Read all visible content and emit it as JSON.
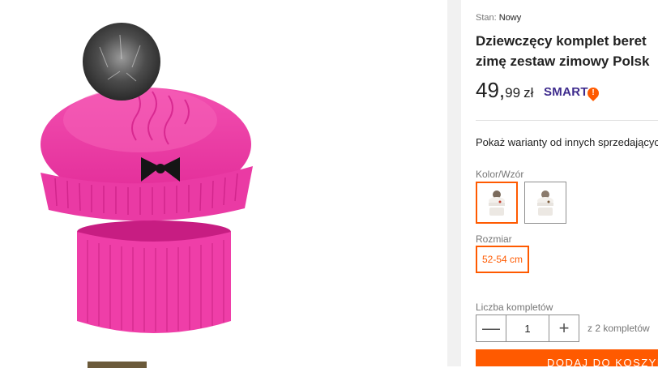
{
  "product": {
    "condition_label": "Stan:",
    "condition_value": "Nowy",
    "title_line1": "Dziewczęcy komplet beret",
    "title_line2": "zimę zestaw zimowy Polsk",
    "price_int": "49,",
    "price_frac": "99",
    "currency": "zł",
    "smart_label": "SMART",
    "smart_badge": "!",
    "variants_link": "Pokaż warianty od innych sprzedającyc"
  },
  "options": {
    "color_label": "Kolor/Wzór",
    "size_label": "Rozmiar",
    "size_value": "52-54 cm",
    "quantity_label": "Liczba kompletów",
    "quantity_value": "1",
    "minus_symbol": "—",
    "plus_symbol": "+",
    "quantity_note": "z 2 kompletów",
    "selected_color_index": 0,
    "swatches": [
      "pink hat set",
      "white hat set"
    ]
  },
  "cart": {
    "button_label": "DODAJ DO KOSZYK"
  },
  "colors": {
    "accent": "#ff5a00",
    "smart_purple": "#3e2b8d",
    "hat_pink": "#f03aa4"
  }
}
